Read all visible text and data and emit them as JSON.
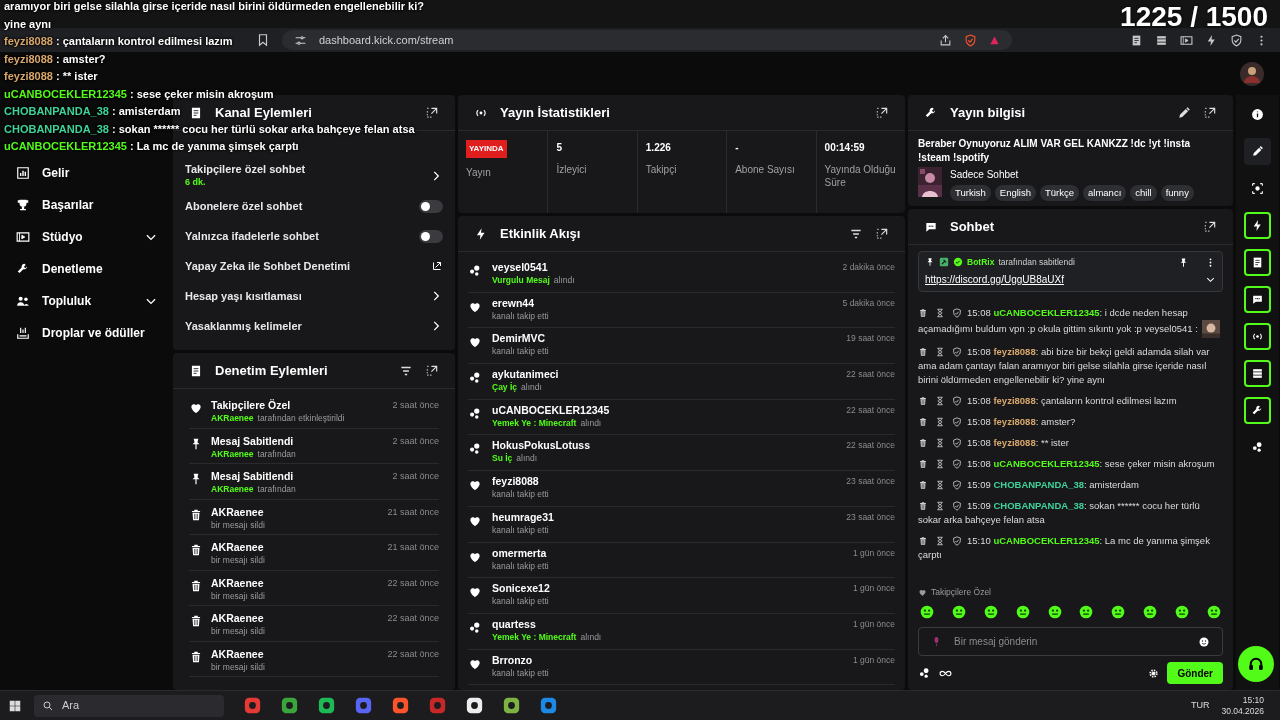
{
  "overlay_counter": "1225 / 1500",
  "overlay_chat": [
    {
      "kind": "continuation",
      "text": "aramıyor biri gelse silahla girse içeride nasıl birini öldürmeden engellenebilir ki?"
    },
    {
      "kind": "continuation",
      "text": "yine aynı"
    },
    {
      "kind": "message",
      "user": "feyzi8088",
      "color": "#d9a86c",
      "text": " : çantaların kontrol edilmesi lazım"
    },
    {
      "kind": "message",
      "user": "feyzi8088",
      "color": "#d9a86c",
      "text": " : amster?"
    },
    {
      "kind": "message",
      "user": "feyzi8088",
      "color": "#d9a86c",
      "text": " : ** ister"
    },
    {
      "kind": "message",
      "user": "uCANBOCEKLER12345",
      "color": "#53fc18",
      "text": " : sese çeker misin akroşum"
    },
    {
      "kind": "message",
      "user": "CHOBANPANDA_38",
      "color": "#3fd39a",
      "text": " : amisterdam"
    },
    {
      "kind": "message",
      "user": "CHOBANPANDA_38",
      "color": "#3fd39a",
      "text": " : sokan ****** cocu her türlü sokar arka bahçeye felan atsa"
    },
    {
      "kind": "message",
      "user": "uCANBOCEKLER12345",
      "color": "#53fc18",
      "text": " : La mc de yanıma şimşek çarptı"
    }
  ],
  "browser": {
    "url": "dashboard.kick.com/stream"
  },
  "sidebar": {
    "items": [
      {
        "kind": "chart",
        "label": "Gelir",
        "selected": false,
        "expandable": false
      },
      {
        "kind": "trophy",
        "label": "Başarılar",
        "selected": false,
        "expandable": false
      },
      {
        "kind": "studio",
        "label": "Stüdyo",
        "selected": false,
        "expandable": true
      },
      {
        "kind": "wrench",
        "label": "Denetleme",
        "selected": false,
        "expandable": false
      },
      {
        "kind": "people",
        "label": "Topluluk",
        "selected": false,
        "expandable": true
      },
      {
        "kind": "drops",
        "label": "Droplar ve ödüller",
        "selected": false,
        "expandable": false
      }
    ]
  },
  "channel_actions": {
    "title": "Kanal Eylemleri",
    "rows": [
      {
        "kind": "nav",
        "label": "Takipçilere özel sohbet",
        "value": "6 dk."
      },
      {
        "kind": "toggle",
        "label": "Abonelere özel sohbet",
        "on": false
      },
      {
        "kind": "toggle",
        "label": "Yalnızca ifadelerle sohbet",
        "on": false
      },
      {
        "kind": "external",
        "label": "Yapay Zeka ile Sohbet Denetimi"
      },
      {
        "kind": "nav",
        "label": "Hesap yaşı kısıtlaması"
      },
      {
        "kind": "nav",
        "label": "Yasaklanmış kelimeler"
      }
    ]
  },
  "mod_actions": {
    "title": "Denetim Eylemleri",
    "rows": [
      {
        "kind": "follower",
        "title": "Takipçilere Özel",
        "actor": "AKRaenee",
        "detail": "tarafından etkinleştirildi",
        "time": "2 saat önce"
      },
      {
        "kind": "pin",
        "title": "Mesaj Sabitlendi",
        "actor": "AKRaenee",
        "detail": "tarafından",
        "time": "2 saat önce"
      },
      {
        "kind": "pin",
        "title": "Mesaj Sabitlendi",
        "actor": "AKRaenee",
        "detail": "tarafından",
        "time": "2 saat önce"
      },
      {
        "kind": "delete",
        "title": "AKRaenee",
        "detail": "bir mesajı sildi",
        "time": "21 saat önce"
      },
      {
        "kind": "delete",
        "title": "AKRaenee",
        "detail": "bir mesajı sildi",
        "time": "21 saat önce"
      },
      {
        "kind": "delete",
        "title": "AKRaenee",
        "detail": "bir mesajı sildi",
        "time": "22 saat önce"
      },
      {
        "kind": "delete",
        "title": "AKRaenee",
        "detail": "bir mesajı sildi",
        "time": "22 saat önce"
      },
      {
        "kind": "delete",
        "title": "AKRaenee",
        "detail": "bir mesajı sildi",
        "time": "22 saat önce"
      }
    ]
  },
  "stats": {
    "title": "Yayın İstatistikleri",
    "cells": [
      {
        "kind": "badge",
        "value": "YAYINDA",
        "label": "Yayın"
      },
      {
        "kind": "number",
        "value": "5",
        "label": "İzleyici"
      },
      {
        "kind": "number",
        "value": "1.226",
        "label": "Takipçi"
      },
      {
        "kind": "number",
        "value": "-",
        "label": "Abone Sayısı"
      },
      {
        "kind": "number",
        "value": "00:14:59",
        "label": "Yayında Olduğu Süre"
      }
    ]
  },
  "activity": {
    "title": "Etkinlik Akışı",
    "rows": [
      {
        "kind": "reward",
        "user": "veysel0541",
        "reward": "Vurgulu Mesaj",
        "detail": "alındı",
        "time": "2 dakika önce"
      },
      {
        "kind": "follow",
        "user": "erewn44",
        "detail": "kanalı takip etti",
        "time": "5 dakika önce"
      },
      {
        "kind": "follow",
        "user": "DemirMVC",
        "detail": "kanalı takip etti",
        "time": "19 saat önce"
      },
      {
        "kind": "reward",
        "user": "aykutanimeci",
        "reward": "Çay İç",
        "detail": "alındı",
        "time": "22 saat önce"
      },
      {
        "kind": "reward",
        "user": "uCANBOCEKLER12345",
        "reward": "Yemek Ye : Minecraft",
        "detail": "alındı",
        "time": "22 saat önce"
      },
      {
        "kind": "reward",
        "user": "HokusPokusLotuss",
        "reward": "Su İç",
        "detail": "alındı",
        "time": "22 saat önce"
      },
      {
        "kind": "follow",
        "user": "feyzi8088",
        "detail": "kanalı takip etti",
        "time": "23 saat önce"
      },
      {
        "kind": "follow",
        "user": "heumrage31",
        "detail": "kanalı takip etti",
        "time": "23 saat önce"
      },
      {
        "kind": "follow",
        "user": "omermerta",
        "detail": "kanalı takip etti",
        "time": "1 gün önce"
      },
      {
        "kind": "follow",
        "user": "Sonicexe12",
        "detail": "kanalı takip etti",
        "time": "1 gün önce"
      },
      {
        "kind": "reward",
        "user": "quartess",
        "reward": "Yemek Ye : Minecraft",
        "detail": "alındı",
        "time": "1 gün önce"
      },
      {
        "kind": "follow",
        "user": "Brronzo",
        "detail": "kanalı takip etti",
        "time": "1 gün önce"
      }
    ]
  },
  "stream_info": {
    "title": "Yayın bilgisi",
    "stream_title": "Beraber Oynuyoruz ALIM VAR GEL KANKZZ !dc !yt !insta !steam !spotify",
    "category": "Sadece Sohbet",
    "tags": [
      "Turkish",
      "English",
      "Türkçe",
      "almancı",
      "chill",
      "funny"
    ]
  },
  "chat": {
    "title": "Sohbet",
    "pinned": {
      "by": "BotRix",
      "by_text": "tarafından sabitlendi",
      "link": "https://discord.gg/UggUB8aUXf"
    },
    "messages": [
      {
        "time": "15:08",
        "user": "uCANBOCEKLER12345",
        "color": "#53fc18",
        "text": ": i dcde neden hesap açamadığımı buldum vpn :p okula gittim sıkıntı yok :p veysel0541 :",
        "emote": true
      },
      {
        "time": "15:08",
        "user": "feyzi8088",
        "color": "#d9a86c",
        "text": ": abi bize bir bekçi geldi adamda silah var ama adam çantayı falan aramıyor biri gelse silahla girse içeride nasıl birini öldürmeden engellenebilir ki? yine aynı",
        "emote": false
      },
      {
        "time": "15:08",
        "user": "feyzi8088",
        "color": "#d9a86c",
        "text": ": çantaların kontrol edilmesi lazım",
        "emote": false
      },
      {
        "time": "15:08",
        "user": "feyzi8088",
        "color": "#d9a86c",
        "text": ": amster?",
        "emote": false
      },
      {
        "time": "15:08",
        "user": "feyzi8088",
        "color": "#d9a86c",
        "text": ": ** ister",
        "emote": false
      },
      {
        "time": "15:08",
        "user": "uCANBOCEKLER12345",
        "color": "#53fc18",
        "text": ": sese çeker misin akroşum",
        "emote": false
      },
      {
        "time": "15:09",
        "user": "CHOBANPANDA_38",
        "color": "#3fd39a",
        "text": ": amisterdam",
        "emote": false
      },
      {
        "time": "15:09",
        "user": "CHOBANPANDA_38",
        "color": "#3fd39a",
        "text": ": sokan ****** cocu her türlü sokar arka bahçeye felan atsa",
        "emote": false
      },
      {
        "time": "15:10",
        "user": "uCANBOCEKLER12345",
        "color": "#53fc18",
        "text": ": La mc de yanıma şimşek çarptı",
        "emote": false
      }
    ],
    "emote_label": "Takipçilere Özel",
    "placeholder": "Bir mesaj gönderin",
    "send": "Gönder"
  },
  "rail": [
    {
      "kind": "info",
      "on": false
    },
    {
      "kind": "pencil",
      "on": false
    },
    {
      "kind": "camera",
      "on": false
    },
    {
      "kind": "bolt",
      "on": true
    },
    {
      "kind": "doc",
      "on": true
    },
    {
      "kind": "chat",
      "on": true
    },
    {
      "kind": "broadcast",
      "on": true
    },
    {
      "kind": "video",
      "on": true
    },
    {
      "kind": "wrench",
      "on": true
    },
    {
      "kind": "dots",
      "on": false
    }
  ],
  "taskbar": {
    "search": "Ara",
    "language": "TUR",
    "time": "15:10",
    "date": "30.04.2026"
  }
}
